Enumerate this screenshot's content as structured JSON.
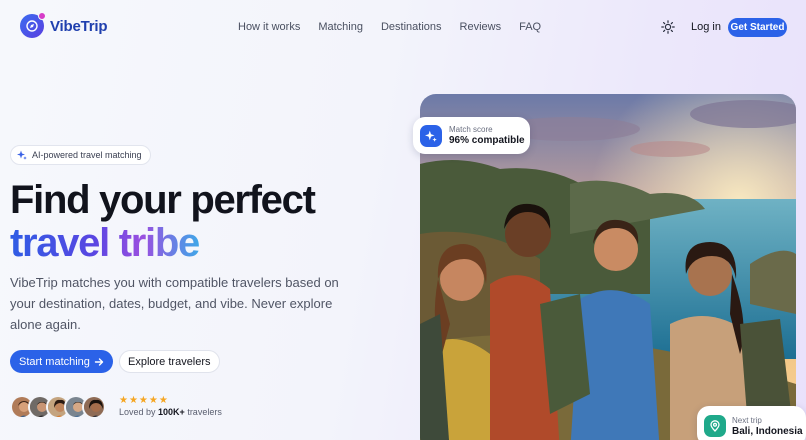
{
  "brand": {
    "name": "VibeTrip",
    "accent": "#2b62e8",
    "accent_purple": "#5a46e2"
  },
  "nav": {
    "links": [
      "How it works",
      "Matching",
      "Destinations",
      "Reviews",
      "FAQ"
    ],
    "theme_icon": "sun-icon",
    "login": "Log in",
    "cta": "Get Started"
  },
  "hero": {
    "pill": "AI-powered travel matching",
    "title_line1": "Find your perfect",
    "title_line2": "travel tribe",
    "description": "VibeTrip matches you with compatible travelers based on your destination, dates, budget, and vibe. Never explore alone again.",
    "primary_button": "Start matching",
    "secondary_button": "Explore travelers",
    "rating_stars": 5,
    "loved_prefix": "Loved by ",
    "loved_count": "100K+",
    "loved_suffix": " travelers"
  },
  "match_badge": {
    "label": "Match score",
    "value": "96% compatible",
    "icon": "sparkle-icon"
  },
  "trip_badge": {
    "label": "Next trip",
    "value": "Bali, Indonesia",
    "icon": "map-pin-icon"
  }
}
